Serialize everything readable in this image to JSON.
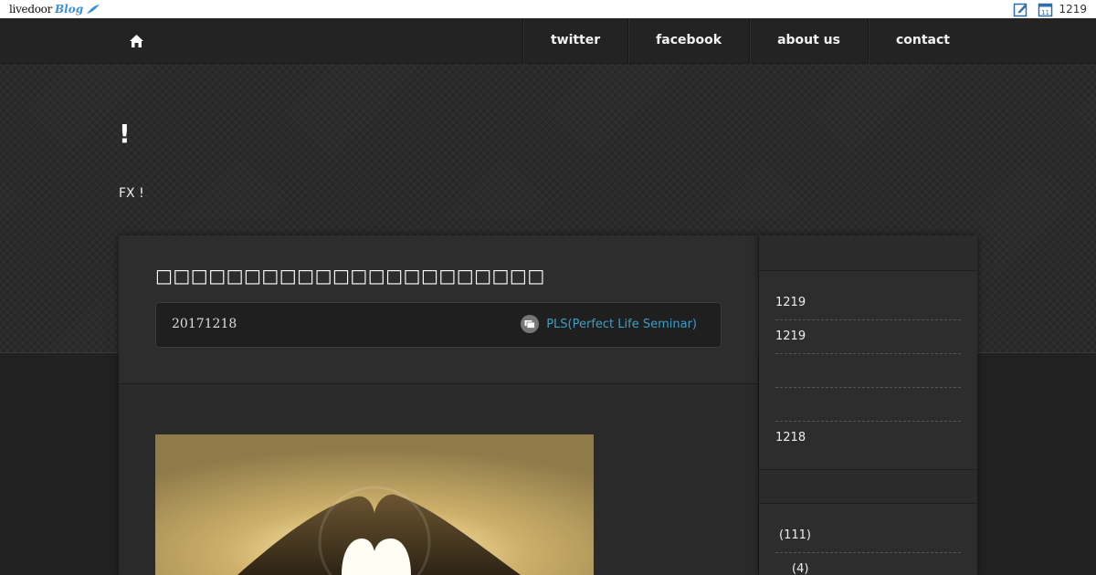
{
  "topbar": {
    "logo_word": "livedoor",
    "logo_blog": "Blog",
    "count": "1219"
  },
  "nav": {
    "links": [
      "twitter",
      "facebook",
      "about us",
      "contact"
    ]
  },
  "hero": {
    "title": "!",
    "description": "FX !"
  },
  "article": {
    "title": "□□□□□□□□□□□□□□□□□□□□□□",
    "date": "20171218",
    "category": "PLS(Perfect Life Seminar)"
  },
  "sidebar": {
    "recent": [
      "1219",
      "1219",
      "",
      "",
      "1218"
    ],
    "categories": [
      "(111)",
      "(4)"
    ]
  },
  "colors": {
    "link": "#3d9fc8",
    "background": "#212121"
  }
}
